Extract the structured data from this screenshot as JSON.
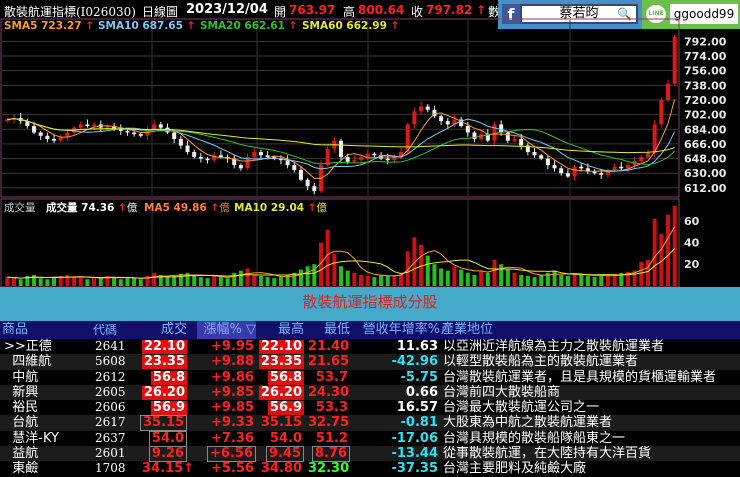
{
  "header": {
    "index_name": "散裝航運指標(I026030)",
    "period": "日線圖",
    "date": "2023/12/04",
    "open_label": "開",
    "open": "763.97",
    "high_label": "高",
    "high": "800.64",
    "close_label": "收",
    "close": "797.82",
    "arrow": "↑",
    "trailing": "數"
  },
  "social": {
    "facebook_name": "蔡若昀",
    "line_id": "ggoodd99"
  },
  "ma_legend": [
    {
      "label": "SMA5 723.27",
      "color": "#ff9a30"
    },
    {
      "label": "SMA10 687.65",
      "color": "#7fc8f0"
    },
    {
      "label": "SMA20 662.61",
      "color": "#30c030"
    },
    {
      "label": "SMA60 662.99",
      "color": "#e8e830"
    }
  ],
  "volume_legend": {
    "title": "成交量",
    "vol_label": "成交量 74.36",
    "unit": "億",
    "ma5": "MA5 49.86",
    "ma10": "MA10 29.04"
  },
  "chart_data": {
    "type": "candlestick",
    "price_axis": {
      "ticks": [
        "792.00",
        "774.00",
        "756.00",
        "738.00",
        "720.00",
        "702.00",
        "684.00",
        "666.00",
        "648.00",
        "630.00",
        "612.00"
      ],
      "range": [
        602,
        806
      ]
    },
    "volume_axis": {
      "ticks": [
        "60",
        "40",
        "20"
      ],
      "range": [
        -4,
        76
      ]
    },
    "closes": [
      696,
      698,
      694,
      688,
      680,
      676,
      672,
      670,
      674,
      680,
      686,
      690,
      688,
      690,
      686,
      688,
      684,
      682,
      680,
      678,
      676,
      684,
      690,
      686,
      680,
      672,
      664,
      656,
      650,
      648,
      646,
      652,
      650,
      648,
      640,
      636,
      650,
      656,
      652,
      650,
      648,
      646,
      640,
      634,
      622,
      614,
      608,
      640,
      660,
      670,
      650,
      644,
      646,
      650,
      654,
      652,
      648,
      646,
      650,
      656,
      690,
      706,
      712,
      708,
      700,
      694,
      690,
      696,
      688,
      680,
      672,
      678,
      670,
      690,
      680,
      670,
      672,
      664,
      656,
      652,
      648,
      640,
      636,
      630,
      626,
      638,
      636,
      632,
      630,
      628,
      634,
      638,
      636,
      640,
      645,
      650,
      655,
      690,
      720,
      740,
      797.82
    ],
    "volumes": [
      8,
      7,
      6,
      9,
      10,
      7,
      6,
      8,
      9,
      10,
      8,
      7,
      6,
      7,
      8,
      9,
      7,
      6,
      8,
      7,
      6,
      9,
      12,
      10,
      8,
      9,
      11,
      12,
      10,
      8,
      7,
      9,
      8,
      7,
      12,
      14,
      16,
      10,
      9,
      8,
      7,
      8,
      10,
      12,
      15,
      18,
      20,
      40,
      52,
      30,
      18,
      14,
      12,
      10,
      9,
      8,
      10,
      9,
      10,
      12,
      32,
      45,
      38,
      28,
      20,
      16,
      14,
      18,
      15,
      12,
      10,
      14,
      12,
      24,
      20,
      16,
      12,
      10,
      9,
      8,
      10,
      12,
      14,
      10,
      9,
      12,
      10,
      9,
      8,
      9,
      10,
      11,
      12,
      13,
      14,
      22,
      24,
      62,
      48,
      66,
      74.36
    ]
  },
  "table": {
    "title": "散裝航運指標成分股",
    "columns": [
      "商品",
      "代碼",
      "成交",
      "漲幅% ▽",
      "最高",
      "最低",
      "營收年增率%",
      "產業地位"
    ],
    "rows": [
      {
        "name": ">>正德",
        "code": "2641",
        "price": "22.10",
        "ps": "limit",
        "chg": "+9.95",
        "cs": "",
        "high": "22.10",
        "hs": "limit",
        "low": "21.40",
        "ls": "pos",
        "yoy": "11.63",
        "ys": "wh",
        "desc": "以亞洲近洋航線為主力之散裝航運業者"
      },
      {
        "name": "  四維航",
        "code": "5608",
        "price": "23.35",
        "ps": "limit",
        "chg": "+9.88",
        "cs": "",
        "high": "23.35",
        "hs": "limit",
        "low": "21.65",
        "ls": "pos",
        "yoy": "-42.96",
        "ys": "cy",
        "desc": "以輕型散裝船為主的散裝航運業者"
      },
      {
        "name": "  中航",
        "code": "2612",
        "price": "56.8",
        "ps": "limit",
        "chg": "+9.86",
        "cs": "",
        "high": "56.8",
        "hs": "limit",
        "low": "53.7",
        "ls": "pos",
        "yoy": "-5.75",
        "ys": "cy",
        "desc": "台灣散裝航運業者，且是具規模的貨櫃運輸業者"
      },
      {
        "name": "  新興",
        "code": "2605",
        "price": "26.20",
        "ps": "limit",
        "chg": "+9.85",
        "cs": "",
        "high": "26.20",
        "hs": "limit",
        "low": "24.30",
        "ls": "pos",
        "yoy": "0.66",
        "ys": "wh",
        "desc": "台灣前四大散裝船商"
      },
      {
        "name": "  裕民",
        "code": "2606",
        "price": "56.9",
        "ps": "limit",
        "chg": "+9.85",
        "cs": "",
        "high": "56.9",
        "hs": "limit",
        "low": "53.3",
        "ls": "pos",
        "yoy": "16.57",
        "ys": "wh",
        "desc": "台灣最大散裝航運公司之一"
      },
      {
        "name": "  台航",
        "code": "2617",
        "price": "35.15",
        "ps": "box",
        "chg": "+9.33",
        "cs": "",
        "high": "35.15",
        "hs": "pos",
        "low": "32.75",
        "ls": "pos",
        "yoy": "-0.81",
        "ys": "cy",
        "desc": "大股東為中航之散裝航運業者"
      },
      {
        "name": "  慧洋-KY",
        "code": "2637",
        "price": "54.0",
        "ps": "box",
        "chg": "+7.36",
        "cs": "",
        "high": "54.0",
        "hs": "pos",
        "low": "51.2",
        "ls": "pos",
        "yoy": "-17.06",
        "ys": "cy",
        "desc": "台灣具規模的散裝船隊船東之一"
      },
      {
        "name": "  益航",
        "code": "2601",
        "price": "9.26",
        "ps": "box",
        "chg": "+6.56",
        "cs": "box",
        "high": "9.45",
        "hs": "box",
        "low": "8.76",
        "ls": "box",
        "yoy": "-13.44",
        "ys": "cy",
        "desc": "從事散裝航運，在大陸持有大洋百貨"
      },
      {
        "name": "  東鹼",
        "code": "1708",
        "price": "34.15↑",
        "ps": "pos",
        "chg": "+5.56",
        "cs": "",
        "high": "34.80",
        "hs": "pos",
        "low": "32.30",
        "ls": "neg",
        "yoy": "-37.35",
        "ys": "cy",
        "desc": "台灣主要肥料及純鹼大廠"
      }
    ]
  }
}
